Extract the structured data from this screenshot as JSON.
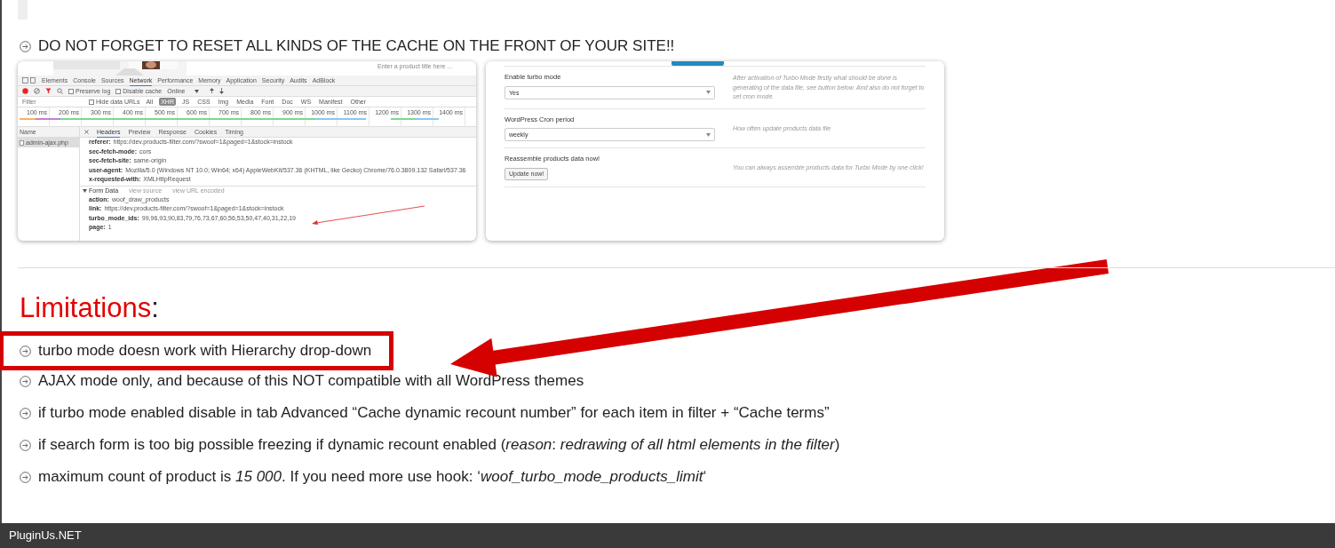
{
  "intro_items": [
    {
      "text": "DO NOT FORGET TO RESET ALL KINDS OF THE CACHE ON THE FRONT OF YOUR SITE!!"
    }
  ],
  "devtools_shot": {
    "page_search_text": "Enter a product title here ...",
    "tabs": [
      {
        "label": "Elements",
        "selected": false
      },
      {
        "label": "Console",
        "selected": false
      },
      {
        "label": "Sources",
        "selected": false
      },
      {
        "label": "Network",
        "selected": true
      },
      {
        "label": "Performance",
        "selected": false
      },
      {
        "label": "Memory",
        "selected": false
      },
      {
        "label": "Application",
        "selected": false
      },
      {
        "label": "Security",
        "selected": false
      },
      {
        "label": "Audits",
        "selected": false
      },
      {
        "label": "AdBlock",
        "selected": false
      }
    ],
    "toolbar": {
      "preserve_log": {
        "label": "Preserve log",
        "checked": false
      },
      "disable_cache": {
        "label": "Disable cache",
        "checked": false
      },
      "throttle": "Online"
    },
    "filter": {
      "placeholder": "Filter",
      "hide_data_urls": {
        "label": "Hide data URLs",
        "checked": false
      }
    },
    "type_filters": [
      {
        "label": "All",
        "selected": false
      },
      {
        "label": "XHR",
        "selected": true
      },
      {
        "label": "JS",
        "selected": false
      },
      {
        "label": "CSS",
        "selected": false
      },
      {
        "label": "Img",
        "selected": false
      },
      {
        "label": "Media",
        "selected": false
      },
      {
        "label": "Font",
        "selected": false
      },
      {
        "label": "Doc",
        "selected": false
      },
      {
        "label": "WS",
        "selected": false
      },
      {
        "label": "Manifest",
        "selected": false
      },
      {
        "label": "Other",
        "selected": false
      }
    ],
    "timeline_ticks": [
      "100 ms",
      "200 ms",
      "300 ms",
      "400 ms",
      "500 ms",
      "600 ms",
      "700 ms",
      "800 ms",
      "900 ms",
      "1000 ms",
      "1100 ms",
      "1200 ms",
      "1300 ms",
      "1400 ms"
    ],
    "name_header": "Name",
    "requests": [
      {
        "name": "admin-ajax.php",
        "selected": true
      }
    ],
    "detail_tabs": [
      {
        "label": "Headers",
        "selected": true
      },
      {
        "label": "Preview",
        "selected": false
      },
      {
        "label": "Response",
        "selected": false
      },
      {
        "label": "Cookies",
        "selected": false
      },
      {
        "label": "Timing",
        "selected": false
      }
    ],
    "headers": [
      {
        "key": "referer:",
        "value": "https://dev.products-filter.com/?swoof=1&paged=1&stock=instock"
      },
      {
        "key": "sec-fetch-mode:",
        "value": "cors"
      },
      {
        "key": "sec-fetch-site:",
        "value": "same-origin"
      },
      {
        "key": "user-agent:",
        "value": "Mozilla/5.0 (Windows NT 10.0; Win64; x64) AppleWebKit/537.36 (KHTML, like Gecko) Chrome/76.0.3809.132 Safari/537.36"
      },
      {
        "key": "x-requested-with:",
        "value": "XMLHttpRequest"
      }
    ],
    "form_data": {
      "title": "Form Data",
      "view_source": "view source",
      "view_url_encoded": "view URL encoded",
      "fields": [
        {
          "key": "action:",
          "value": "woof_draw_products"
        },
        {
          "key": "link:",
          "value": "https://dev.products-filter.com/?swoof=1&paged=1&stock=instock"
        },
        {
          "key": "turbo_mode_ids:",
          "value": "99,96,93,90,83,79,76,73,67,60,56,53,50,47,40,31,22,19"
        },
        {
          "key": "page:",
          "value": "1"
        }
      ]
    }
  },
  "settings_shot": {
    "rows": [
      {
        "kind": "select",
        "label": "Enable turbo mode",
        "value": "Yes",
        "help": "After activation of Turbo Mode firstly what should be done is generating of the data file, see button below. And also do not forget to set cron mode."
      },
      {
        "kind": "select",
        "label": "WordPress Cron period",
        "value": "weekly",
        "help": "How often update products data file"
      },
      {
        "kind": "button",
        "label": "Reassemble products data now!",
        "value": "Update now!",
        "help": "You can always assemble products data for Turbo Mode by one click!"
      }
    ]
  },
  "limitations": {
    "title": "Limitations",
    "title_suffix": ":",
    "items": [
      {
        "text": "turbo mode doesn work with Hierarchy drop-down",
        "highlighted": true
      },
      {
        "text": "AJAX mode only, and because of this NOT compatible with all WordPress themes",
        "highlighted": false
      },
      {
        "text": "if turbo mode enabled disable in tab Advanced “Cache dynamic recount number” for each item in filter + “Cache terms”",
        "highlighted": false
      },
      {
        "text": "if search form is too big possible freezing if dynamic recount enabled (*reason*: *redrawing of all html elements in the filter*)",
        "highlighted": false
      },
      {
        "text": "maximum count of product is *15 000*. If you need more use hook: ‘*woof_turbo_mode_products_limit*‘",
        "highlighted": false
      }
    ]
  },
  "footer": {
    "brand": "PluginUs.NET"
  }
}
